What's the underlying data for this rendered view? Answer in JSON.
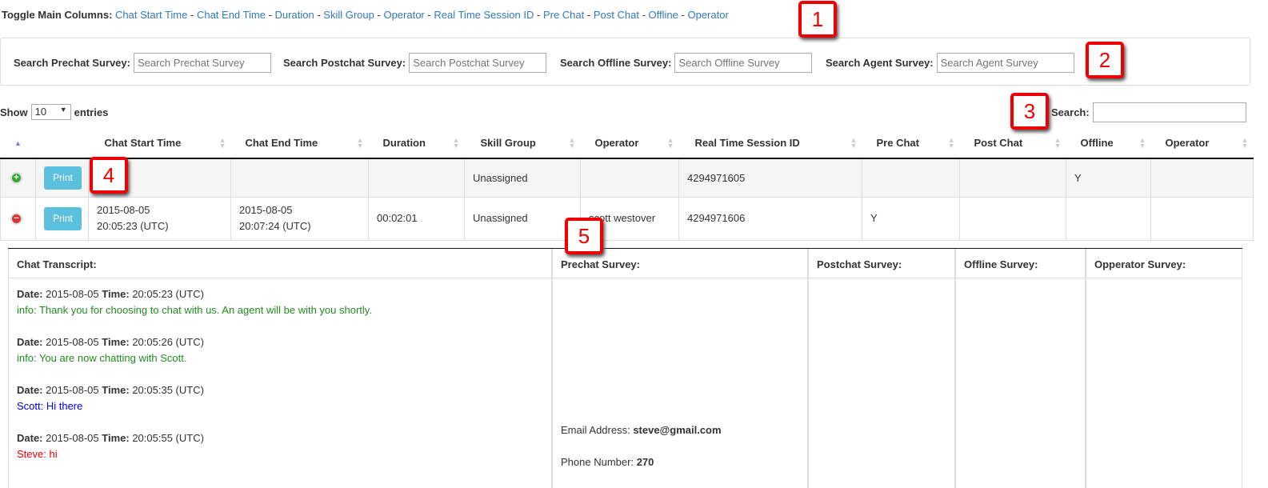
{
  "toggle": {
    "label": "Toggle Main Columns:",
    "links": [
      "Chat Start Time",
      "Chat End Time",
      "Duration",
      "Skill Group",
      "Operator",
      "Real Time Session ID",
      "Pre Chat",
      "Post Chat",
      "Offline",
      "Operator"
    ],
    "sep": "-"
  },
  "surveys": [
    {
      "label": "Search Prechat Survey:",
      "placeholder": "Search Prechat Survey"
    },
    {
      "label": "Search Postchat Survey:",
      "placeholder": "Search Postchat Survey"
    },
    {
      "label": "Search Offline Survey:",
      "placeholder": "Search Offline Survey"
    },
    {
      "label": "Search Agent Survey:",
      "placeholder": "Search Agent Survey"
    }
  ],
  "length": {
    "show": "Show",
    "value": "10",
    "entries": "entries"
  },
  "search": {
    "label": "Search:"
  },
  "columns": [
    "Chat Start Time",
    "Chat End Time",
    "Duration",
    "Skill Group",
    "Operator",
    "Real Time Session ID",
    "Pre Chat",
    "Post Chat",
    "Offline",
    "Operator"
  ],
  "print": "Print",
  "rows": [
    {
      "start": "",
      "end": "",
      "duration": "",
      "skill": "Unassigned",
      "operator": "",
      "session": "4294971605",
      "pre": "",
      "post": "",
      "offline": "Y",
      "op2": ""
    },
    {
      "start_date": "2015-08-05",
      "start_time": "20:05:23 (UTC)",
      "end_date": "2015-08-05",
      "end_time": "20:07:24 (UTC)",
      "duration": "00:02:01",
      "skill": "Unassigned",
      "operator": "scott westover",
      "session": "4294971606",
      "pre": "Y",
      "post": "",
      "offline": "",
      "op2": ""
    }
  ],
  "detail": {
    "headers": [
      "Chat Transcript:",
      "Prechat Survey:",
      "Postchat Survey:",
      "Offline Survey:",
      "Opperator Survey:"
    ],
    "date_label": "Date:",
    "time_label": "Time:",
    "messages": [
      {
        "date": "2015-08-05",
        "time": "20:05:23 (UTC)",
        "text": "info: Thank you for choosing to chat with us. An agent will be with you shortly.",
        "color": "#228b22"
      },
      {
        "date": "2015-08-05",
        "time": "20:05:26 (UTC)",
        "text": "info: You are now chatting with Scott.",
        "color": "#228b22"
      },
      {
        "date": "2015-08-05",
        "time": "20:05:35 (UTC)",
        "text": "Scott: Hi there",
        "color": "#0000ee"
      },
      {
        "date": "2015-08-05",
        "time": "20:05:55 (UTC)",
        "text": "Steve: hi",
        "color": "#ee0000"
      }
    ],
    "email_label": "Email Address:",
    "email": "steve@gmail.com",
    "phone_label": "Phone Number:",
    "phone": "270"
  },
  "callouts": [
    "1",
    "2",
    "3",
    "4",
    "5"
  ]
}
